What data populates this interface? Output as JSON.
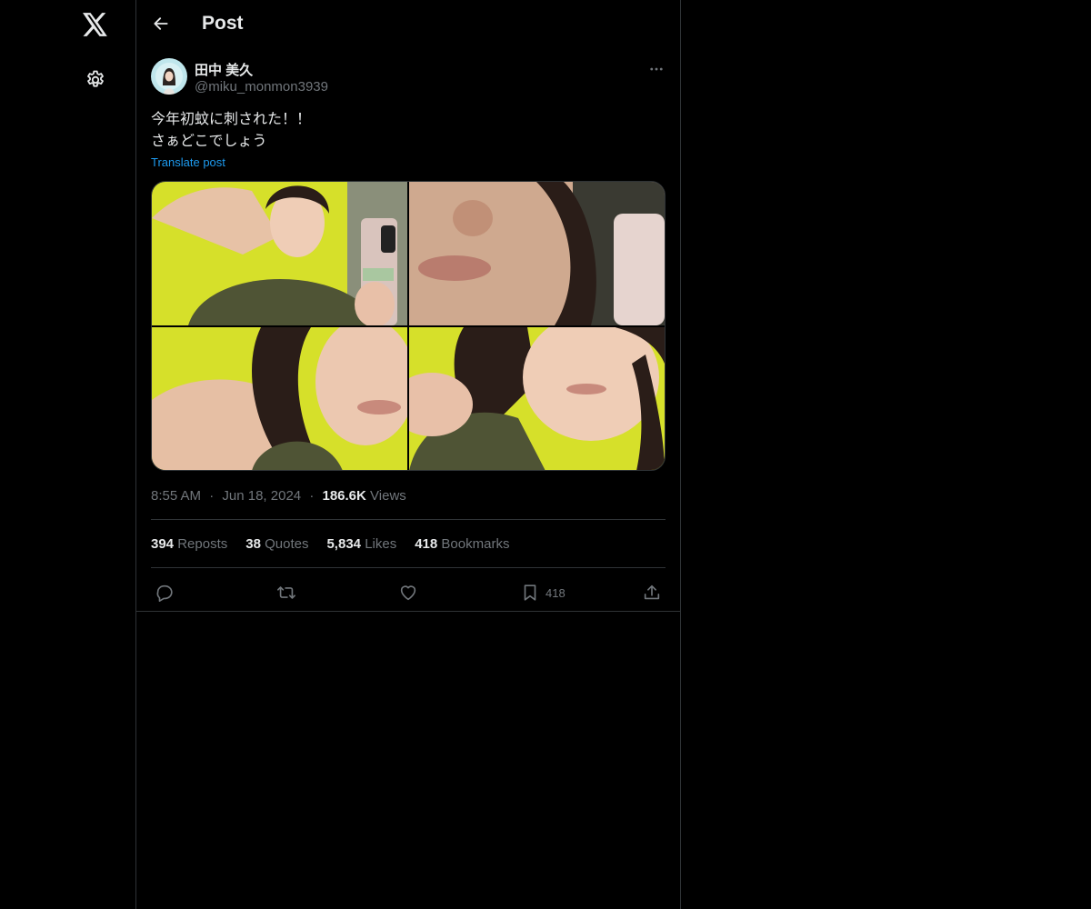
{
  "rail": {
    "logo_icon": "x-logo-icon",
    "settings_icon": "gear-icon"
  },
  "header": {
    "back_icon": "arrow-left-icon",
    "title": "Post"
  },
  "post": {
    "author": {
      "display_name": "田中 美久",
      "handle": "@miku_monmon3939"
    },
    "text_lines": [
      "今年初蚊に刺された！！",
      "さぁどこでしょう"
    ],
    "translate_label": "Translate post",
    "media_count": 4,
    "time": "8:55 AM",
    "separator": "·",
    "date": "Jun 18, 2024",
    "views_count": "186.6K",
    "views_label": "Views",
    "stats": {
      "reposts": {
        "count": "394",
        "label": "Reposts"
      },
      "quotes": {
        "count": "38",
        "label": "Quotes"
      },
      "likes": {
        "count": "5,834",
        "label": "Likes"
      },
      "bookmarks": {
        "count": "418",
        "label": "Bookmarks"
      }
    },
    "actions": {
      "reply_icon": "reply-icon",
      "repost_icon": "repost-icon",
      "like_icon": "heart-icon",
      "bookmark_icon": "bookmark-icon",
      "bookmark_count": "418",
      "share_icon": "share-icon"
    }
  },
  "colors": {
    "background": "#000000",
    "text": "#e7e9ea",
    "muted": "#71767b",
    "link": "#1d9bf0",
    "border": "#2f3336"
  }
}
